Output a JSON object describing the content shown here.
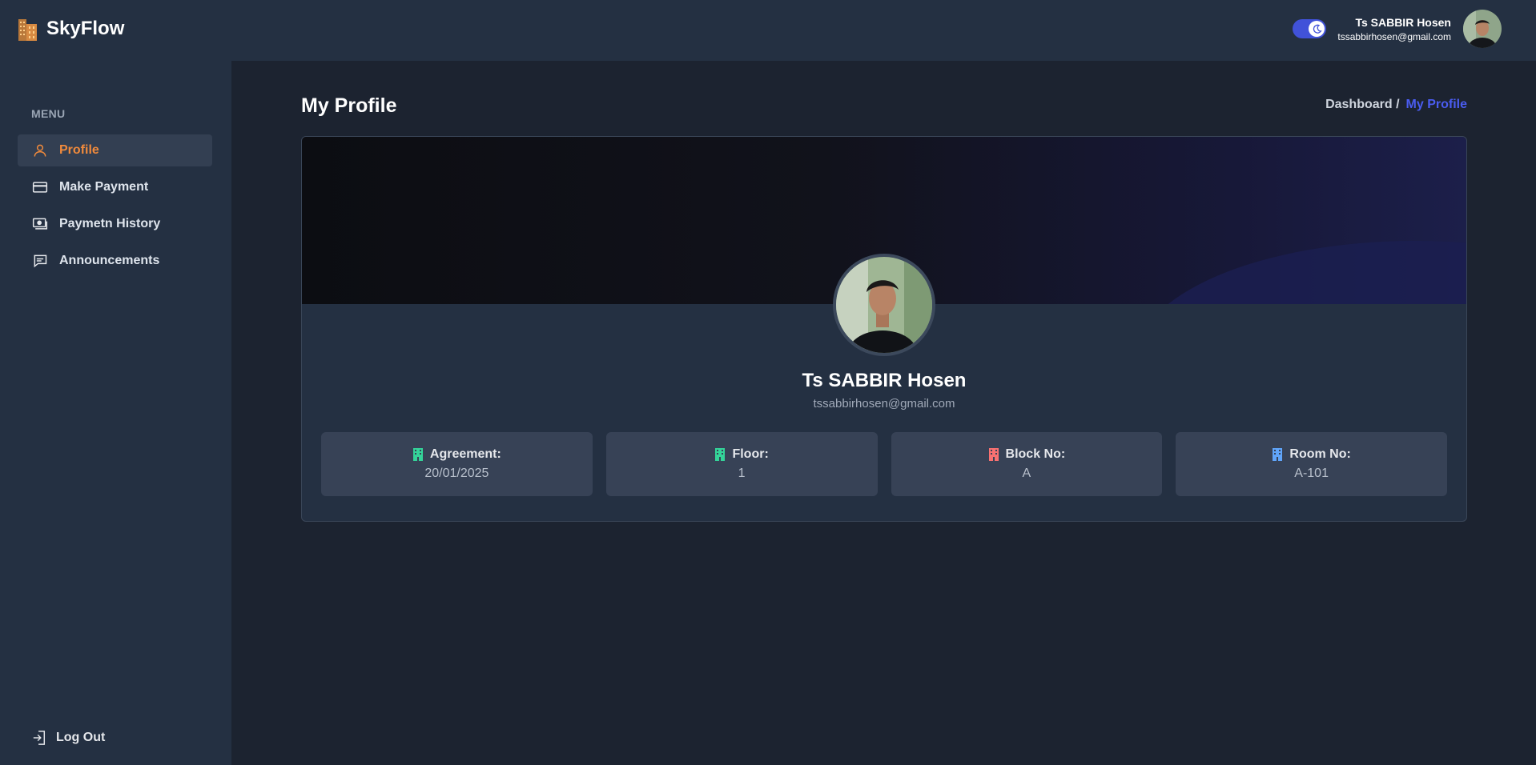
{
  "app": {
    "name": "SkyFlow"
  },
  "sidebar": {
    "menu_label": "MENU",
    "items": [
      {
        "label": "Profile",
        "icon": "user-icon",
        "active": true
      },
      {
        "label": "Make Payment",
        "icon": "credit-card-icon",
        "active": false
      },
      {
        "label": "Paymetn History",
        "icon": "money-icon",
        "active": false
      },
      {
        "label": "Announcements",
        "icon": "message-icon",
        "active": false
      }
    ],
    "logout_label": "Log Out"
  },
  "header": {
    "theme_toggle": {
      "on": true,
      "icon": "moon-icon"
    },
    "user": {
      "name": "Ts SABBIR Hosen",
      "email": "tssabbirhosen@gmail.com"
    }
  },
  "page": {
    "title": "My Profile",
    "breadcrumb": {
      "parent": "Dashboard /",
      "current": "My Profile"
    }
  },
  "profile": {
    "name": "Ts SABBIR Hosen",
    "email": "tssabbirhosen@gmail.com",
    "info": [
      {
        "label": "Agreement:",
        "value": "20/01/2025",
        "icon_color": "#34d399"
      },
      {
        "label": "Floor:",
        "value": "1",
        "icon_color": "#34d399"
      },
      {
        "label": "Block No:",
        "value": "A",
        "icon_color": "#f87171"
      },
      {
        "label": "Room No:",
        "value": "A-101",
        "icon_color": "#60a5fa"
      }
    ]
  },
  "colors": {
    "accent_active": "#f08a3c",
    "link": "#4a5cf0",
    "toggle": "#4152d9"
  }
}
